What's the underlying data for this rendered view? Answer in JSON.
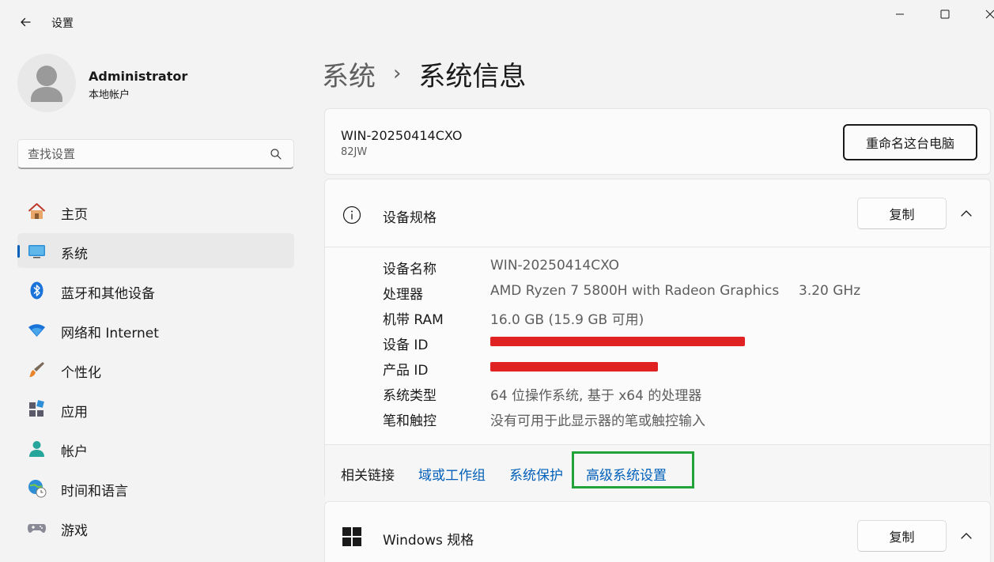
{
  "window": {
    "title": "设置"
  },
  "profile": {
    "name": "Administrator",
    "account_type": "本地帐户"
  },
  "search": {
    "placeholder": "查找设置"
  },
  "nav": {
    "items": [
      {
        "label": "主页",
        "icon": "home-icon"
      },
      {
        "label": "系统",
        "icon": "system-icon",
        "active": true
      },
      {
        "label": "蓝牙和其他设备",
        "icon": "bluetooth-icon"
      },
      {
        "label": "网络和 Internet",
        "icon": "wifi-icon"
      },
      {
        "label": "个性化",
        "icon": "brush-icon"
      },
      {
        "label": "应用",
        "icon": "apps-icon"
      },
      {
        "label": "帐户",
        "icon": "account-icon"
      },
      {
        "label": "时间和语言",
        "icon": "globe-clock-icon"
      },
      {
        "label": "游戏",
        "icon": "gamepad-icon"
      }
    ]
  },
  "breadcrumb": {
    "parent": "系统",
    "separator": "›",
    "current": "系统信息"
  },
  "pc": {
    "name": "WIN-20250414CXO",
    "model": "82JW",
    "rename_label": "重命名这台电脑"
  },
  "device_specs": {
    "title": "设备规格",
    "copy_label": "复制",
    "rows": [
      {
        "label": "设备名称",
        "value": "WIN-20250414CXO"
      },
      {
        "label": "处理器",
        "value": "AMD Ryzen 7 5800H with Radeon Graphics",
        "extra": "3.20 GHz"
      },
      {
        "label": "机带 RAM",
        "value": "16.0 GB (15.9 GB 可用)"
      },
      {
        "label": "设备 ID",
        "value": ""
      },
      {
        "label": "产品 ID",
        "value": ""
      },
      {
        "label": "系统类型",
        "value": "64 位操作系统, 基于 x64 的处理器"
      },
      {
        "label": "笔和触控",
        "value": "没有可用于此显示器的笔或触控输入"
      }
    ]
  },
  "related": {
    "label": "相关链接",
    "links": [
      "域或工作组",
      "系统保护",
      "高级系统设置"
    ]
  },
  "windows_specs": {
    "title": "Windows 规格",
    "copy_label": "复制"
  },
  "colors": {
    "accent": "#005fb8",
    "highlight": "#22a33a",
    "redaction": "#e02222"
  }
}
